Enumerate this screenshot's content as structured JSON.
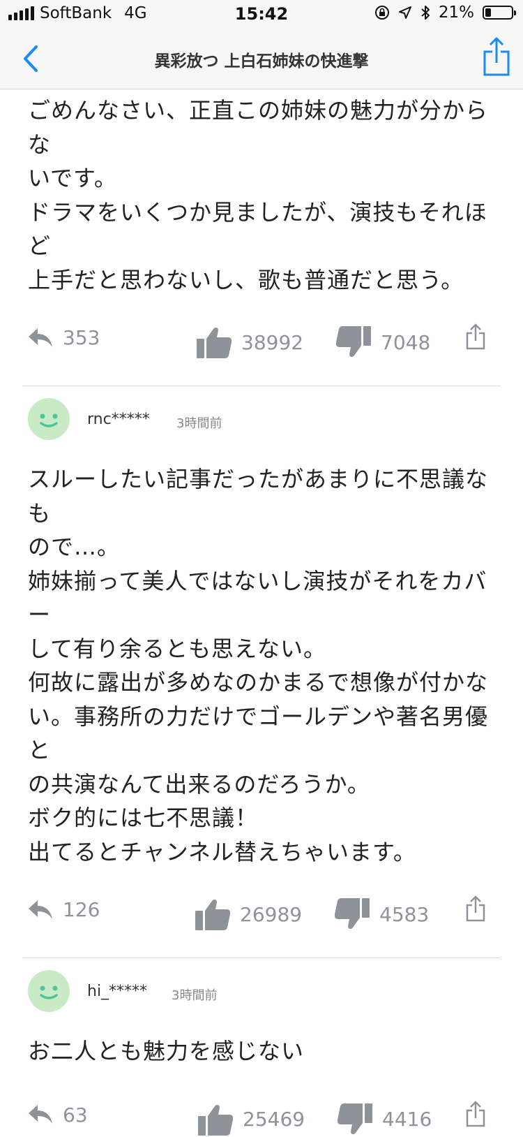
{
  "status_bar": {
    "carrier": "SoftBank",
    "network": "4G",
    "time": "15:42",
    "battery": "21%",
    "battery_level": 0.21
  },
  "nav": {
    "title": "異彩放つ 上白石姉妹の快進撃",
    "back_icon": "chevron-left-icon",
    "share_icon": "share-icon"
  },
  "comments": [
    {
      "text": "ごめんなさい、正直この姉妹の魅力が分からな\nいです。\nドラマをいくつか見ましたが、演技もそれほど\n上手だと思わないし、歌も普通だと思う。",
      "replies": "353",
      "likes": "38992",
      "dislikes": "7048"
    },
    {
      "user": "rnc*****",
      "time": "3時間前",
      "text": "スルーしたい記事だったがあまりに不思議なも\nので…。\n姉妹揃って美人ではないし演技がそれをカバー\nして有り余るとも思えない。\n何故に露出が多めなのかまるで想像が付かな\nい。事務所の力だけでゴールデンや著名男優と\nの共演なんて出来るのだろうか。\nボク的には七不思議！\n出てるとチャンネル替えちゃいます。",
      "replies": "126",
      "likes": "26989",
      "dislikes": "4583"
    },
    {
      "user": "hi_*****",
      "time": "3時間前",
      "text": "お二人とも魅力を感じない",
      "replies": "63",
      "likes": "25469",
      "dislikes": "4416"
    }
  ],
  "colors": {
    "accent": "#1a8cf0",
    "icon_gray": "#8e939a",
    "avatar_bg": "#c8ebc5",
    "avatar_face": "#4fc39a"
  }
}
